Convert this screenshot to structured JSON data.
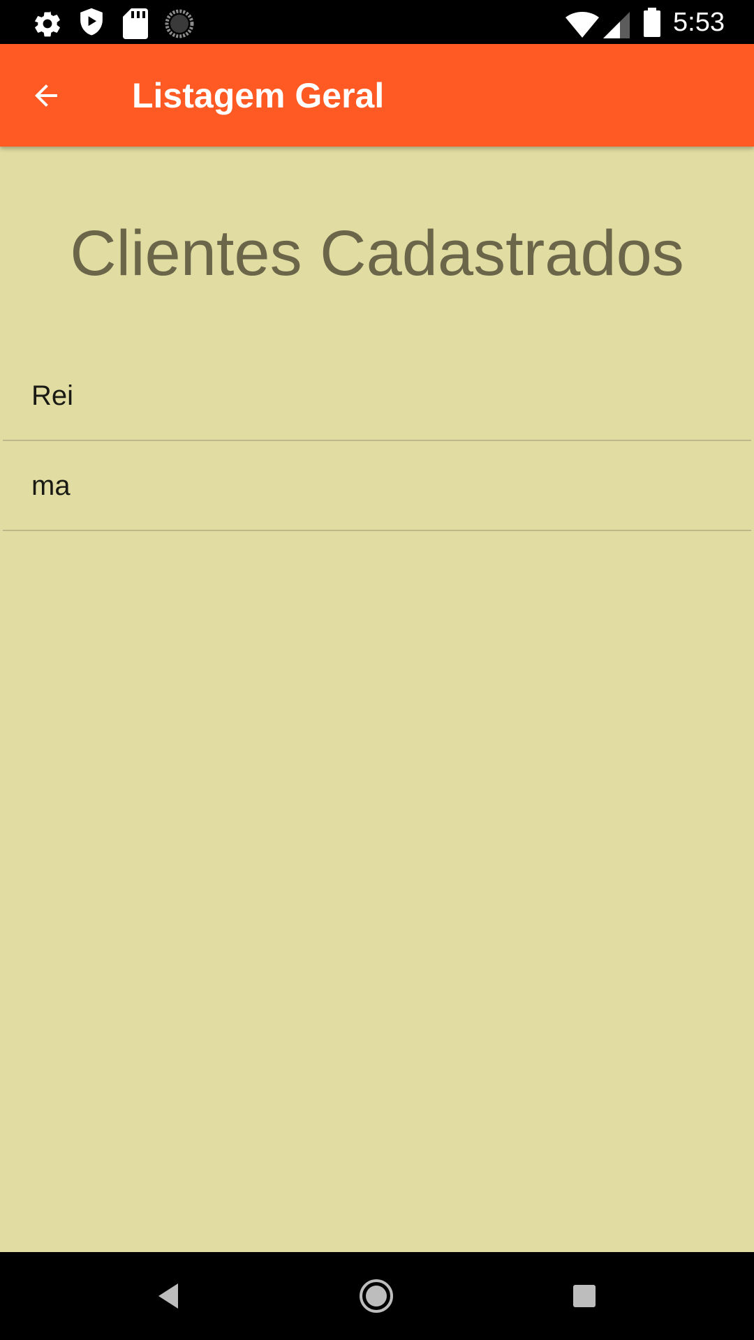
{
  "status_bar": {
    "time": "5:53",
    "icons": [
      "settings-icon",
      "shield-play-icon",
      "sd-card-icon",
      "loading-icon",
      "wifi-icon",
      "signal-icon",
      "battery-icon"
    ]
  },
  "app_bar": {
    "title": "Listagem Geral",
    "back_icon": "arrow-back-icon",
    "background_color": "#ff5a24"
  },
  "main": {
    "heading": "Clientes Cadastrados",
    "clients": [
      {
        "name": "Rei"
      },
      {
        "name": "ma"
      }
    ],
    "background_color": "#e0dca2"
  },
  "nav_bar": {
    "buttons": [
      "back-triangle-icon",
      "home-circle-icon",
      "recents-square-icon"
    ]
  }
}
